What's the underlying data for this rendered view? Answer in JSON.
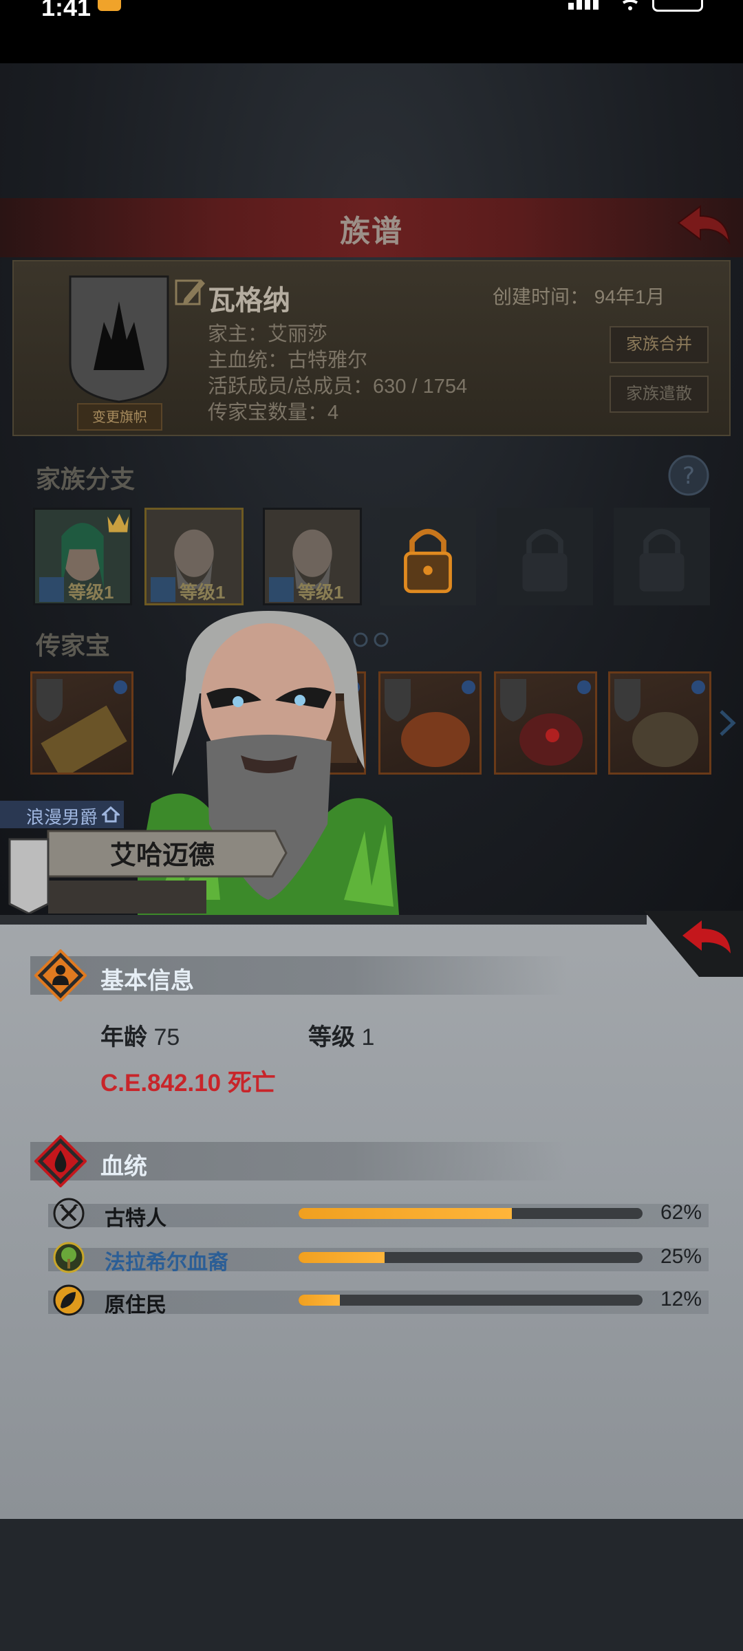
{
  "status_bar": {
    "time": "1:41"
  },
  "header": {
    "title": "族谱"
  },
  "family": {
    "name": "瓦格纳",
    "created": "创建时间： 94年1月",
    "patriarch": "家主：艾丽莎",
    "main_bloodline": "主血统：古特雅尔",
    "members": "活跃成员/总成员：630 / 1754",
    "heirloom_count": "传家宝数量：4",
    "change_banner": "变更旗帜",
    "merge_button": "家族合并",
    "disband_button": "家族遣散"
  },
  "branches": {
    "label": "家族分支",
    "slots": [
      {
        "level": "等级1",
        "state": "leader"
      },
      {
        "level": "等级1",
        "state": "selected"
      },
      {
        "level": "等级1",
        "state": "normal"
      },
      {
        "state": "unlockable"
      },
      {
        "state": "locked"
      },
      {
        "state": "locked"
      }
    ]
  },
  "heirlooms": {
    "label": "传家宝",
    "count": 6
  },
  "character": {
    "title": "浪漫男爵",
    "name": "艾哈迈德"
  },
  "basic_info": {
    "title": "基本信息",
    "age_label": "年龄",
    "age": "75",
    "level_label": "等级",
    "level": "1",
    "death": "C.E.842.10 死亡"
  },
  "bloodline": {
    "title": "血统",
    "entries": [
      {
        "name": "古特人",
        "percent": 62,
        "percent_text": "62%",
        "icon": "crossed-axes-icon",
        "color": "#1a1a1a"
      },
      {
        "name": "法拉希尔血裔",
        "percent": 25,
        "percent_text": "25%",
        "icon": "tree-icon",
        "color": "#2b5e96"
      },
      {
        "name": "原住民",
        "percent": 12,
        "percent_text": "12%",
        "icon": "leaf-icon",
        "color": "#1a1a1a"
      }
    ]
  },
  "colors": {
    "accent_orange": "#f0a020",
    "death_red": "#c8252a",
    "header_red": "#6a2020",
    "panel_gray": "#9a9fa4"
  }
}
